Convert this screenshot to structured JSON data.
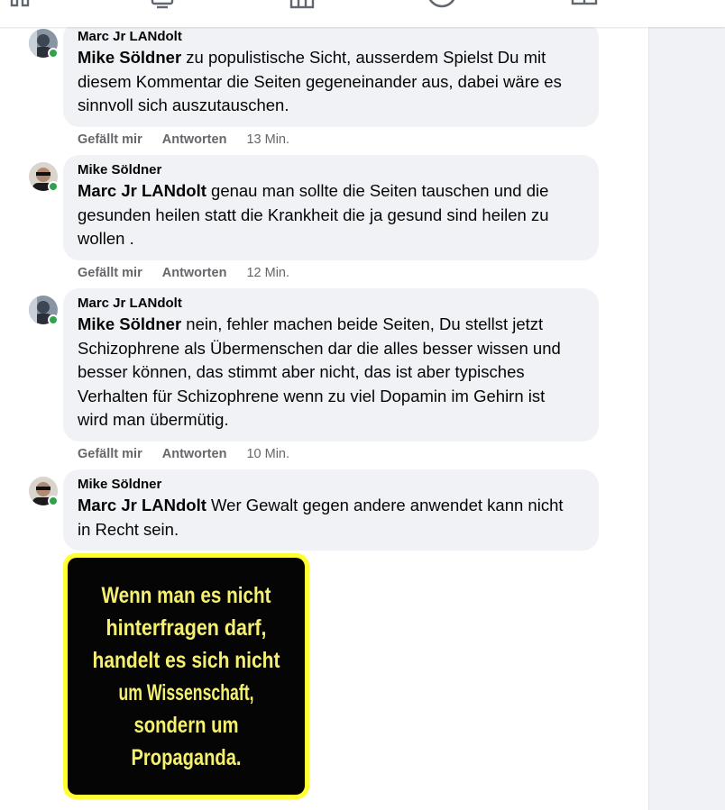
{
  "comments": [
    {
      "author": "Marc Jr LANdolt",
      "mention": "Mike Söldner",
      "text_lines": [
        "zu populistische Sicht, ausserdem Spielst Du mit",
        "diesem Kommentar die Seiten gegeneinander aus, dabei wäre es",
        "sinnvoll sich auszutauschen."
      ],
      "like": "Gefällt mir",
      "reply": "Antworten",
      "time": "13 Min."
    },
    {
      "author": "Mike Söldner",
      "mention": "Marc Jr LANdolt",
      "text_lines": [
        "genau man sollte die Seiten tauschen und die",
        "gesunden heilen statt die Krankheit die ja gesund sind heilen zu",
        "wollen ."
      ],
      "like": "Gefällt mir",
      "reply": "Antworten",
      "time": "12 Min."
    },
    {
      "author": "Marc Jr LANdolt",
      "mention": "Mike Söldner",
      "text_lines": [
        "nein, fehler machen beide Seiten, Du stellst jetzt",
        "Schizophrene als Übermenschen dar die alles besser wissen und",
        "besser können, das stimmt aber nicht, das ist aber typisches",
        "Verhalten für Schizophrene wenn zu viel Dopamin im Gehirn ist",
        "wird man übermütig."
      ],
      "like": "Gefällt mir",
      "reply": "Antworten",
      "time": "10 Min."
    },
    {
      "author": "Mike Söldner",
      "mention": "Marc Jr LANdolt",
      "text_lines": [
        "Wer Gewalt gegen andere anwendet kann nicht",
        "in Recht sein."
      ]
    }
  ],
  "poster": {
    "lines": [
      "Wenn man es nicht",
      "hinterfragen darf,",
      "handelt es sich nicht",
      "um Wissenschaft,",
      "sondern um",
      "Propaganda."
    ],
    "text_color": "#f5f070",
    "frame_color": "#ffff33"
  },
  "icons": [
    "grid-icon",
    "tv-icon",
    "marketplace-icon",
    "groups-icon",
    "gaming-icon"
  ],
  "colors": {
    "bubble": "#f0f2f5",
    "online": "#31a24c",
    "meta_text": "#65676b"
  }
}
